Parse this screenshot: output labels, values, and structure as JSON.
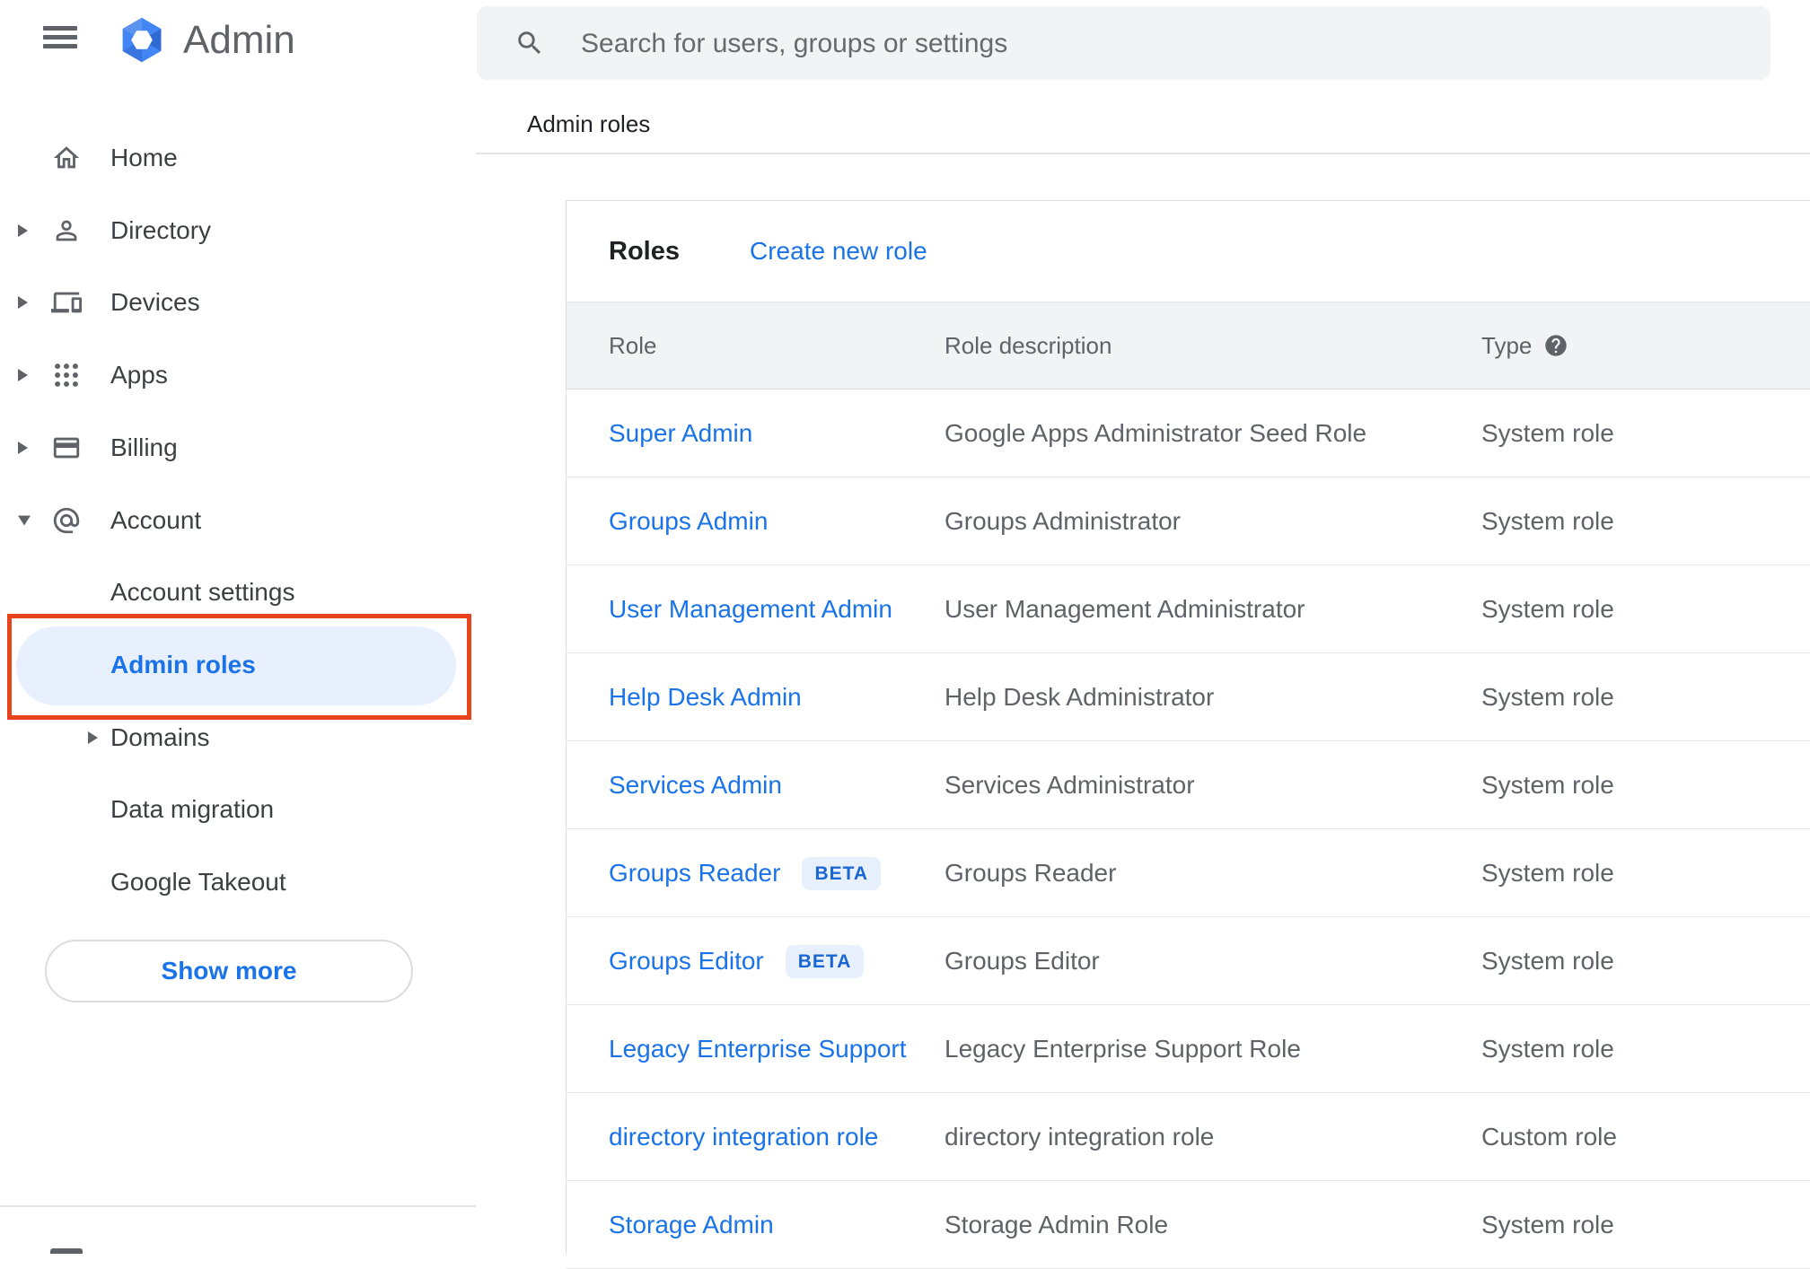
{
  "topbar": {
    "app_name": "Admin",
    "search_placeholder": "Search for users, groups or settings"
  },
  "sidebar": {
    "rows": [
      {
        "label": "Home",
        "icon": "home-icon"
      },
      {
        "label": "Directory",
        "icon": "person-icon",
        "expand": "collapsed"
      },
      {
        "label": "Devices",
        "icon": "devices-icon",
        "expand": "collapsed"
      },
      {
        "label": "Apps",
        "icon": "apps-icon",
        "expand": "collapsed"
      },
      {
        "label": "Billing",
        "icon": "credit-card-icon",
        "expand": "collapsed"
      },
      {
        "label": "Account",
        "icon": "at-sign-icon",
        "expand": "expanded"
      },
      {
        "label": "Account settings",
        "indent": true
      },
      {
        "label": "Admin roles",
        "indent": true,
        "active": true
      },
      {
        "label": "Domains",
        "indent": true,
        "expand": "collapsed"
      },
      {
        "label": "Data migration",
        "indent": true
      },
      {
        "label": "Google Takeout",
        "indent": true
      }
    ],
    "show_more_label": "Show more"
  },
  "page": {
    "breadcrumb": "Admin roles"
  },
  "roles_card": {
    "title": "Roles",
    "create_link": "Create new role",
    "beta_label": "BETA",
    "table": {
      "columns": [
        "Role",
        "Role description",
        "Type"
      ],
      "rows": [
        {
          "role": "Super Admin",
          "beta": false,
          "description": "Google Apps Administrator Seed Role",
          "type": "System role"
        },
        {
          "role": "Groups Admin",
          "beta": false,
          "description": "Groups Administrator",
          "type": "System role"
        },
        {
          "role": "User Management Admin",
          "beta": false,
          "description": "User Management Administrator",
          "type": "System role"
        },
        {
          "role": "Help Desk Admin",
          "beta": false,
          "description": "Help Desk Administrator",
          "type": "System role"
        },
        {
          "role": "Services Admin",
          "beta": false,
          "description": "Services Administrator",
          "type": "System role"
        },
        {
          "role": "Groups Reader",
          "beta": true,
          "description": "Groups Reader",
          "type": "System role"
        },
        {
          "role": "Groups Editor",
          "beta": true,
          "description": "Groups Editor",
          "type": "System role"
        },
        {
          "role": "Legacy Enterprise Support",
          "beta": false,
          "description": "Legacy Enterprise Support Role",
          "type": "System role"
        },
        {
          "role": "directory integration role",
          "beta": false,
          "description": "directory integration role",
          "type": "Custom role"
        },
        {
          "role": "Storage Admin",
          "beta": false,
          "description": "Storage Admin Role",
          "type": "System role"
        }
      ]
    }
  },
  "colors": {
    "link_blue": "#1a73e8",
    "active_item_bg": "#e8f0fe",
    "annotation_red": "#e8431c",
    "beta_bg": "#e8f0fe",
    "beta_text": "#1967d2",
    "table_header_bg": "#f1f3f4",
    "search_bg": "#f1f3f4",
    "icon_gray": "#5f6368",
    "text_dark": "#202124",
    "text_gray": "#5f6368",
    "logo_blue": "#4285f4"
  }
}
